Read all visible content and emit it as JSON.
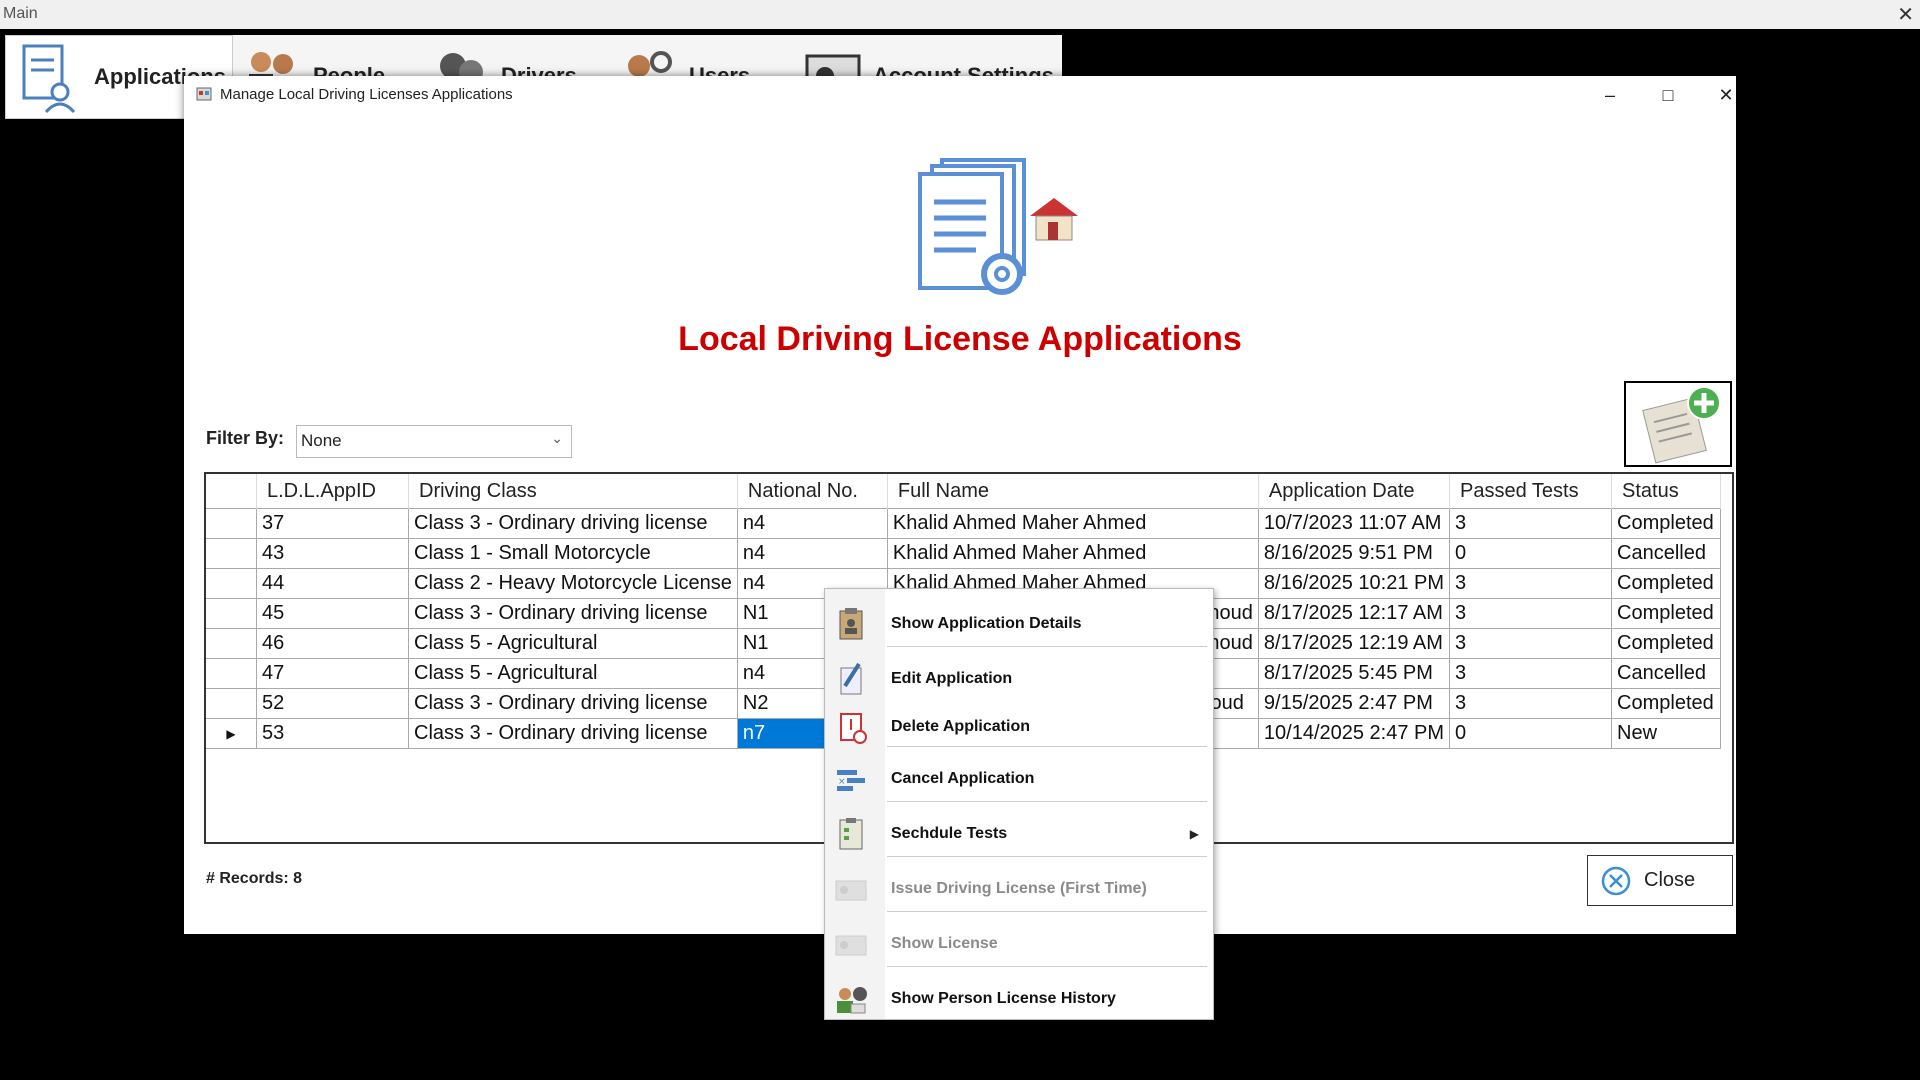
{
  "main_window": {
    "title": "Main"
  },
  "toolbar": {
    "items": [
      {
        "label": "Applications"
      },
      {
        "label": "People"
      },
      {
        "label": "Drivers"
      },
      {
        "label": "Users"
      },
      {
        "label": "Account Settings"
      }
    ]
  },
  "child_window": {
    "title": "Manage Local Driving Licenses Applications",
    "heading": "Local Driving License Applications",
    "heading_color": "#cc0000"
  },
  "filter": {
    "label": "Filter By:",
    "value": "None"
  },
  "grid": {
    "columns": [
      "L.D.L.AppID",
      "Driving Class",
      "National No.",
      "Full Name",
      "Application Date",
      "Passed Tests",
      "Status"
    ],
    "rows": [
      [
        "37",
        "Class 3 - Ordinary driving license",
        "n4",
        "Khalid Ahmed Maher Ahmed",
        "10/7/2023 11:07 AM",
        "3",
        "Completed"
      ],
      [
        "43",
        "Class 1 - Small Motorcycle",
        "n4",
        "Khalid Ahmed Maher Ahmed",
        "8/16/2025 9:51 PM",
        "0",
        "Cancelled"
      ],
      [
        "44",
        "Class 2 - Heavy Motorcycle License",
        "n4",
        "Khalid Ahmed Maher Ahmed",
        "8/16/2025 10:21 PM",
        "3",
        "Completed"
      ],
      [
        "45",
        "Class 3 - Ordinary driving license",
        "N1",
        "houd",
        "8/17/2025 12:17 AM",
        "3",
        "Completed"
      ],
      [
        "46",
        "Class 5 - Agricultural",
        "N1",
        "houd",
        "8/17/2025 12:19 AM",
        "3",
        "Completed"
      ],
      [
        "47",
        "Class 5 - Agricultural",
        "n4",
        "",
        "8/17/2025 5:45 PM",
        "3",
        "Cancelled"
      ],
      [
        "52",
        "Class 3 - Ordinary driving license",
        "N2",
        "oud",
        "9/15/2025 2:47 PM",
        "3",
        "Completed"
      ],
      [
        "53",
        "Class 3 - Ordinary driving license",
        "n7",
        "",
        "10/14/2025 2:47 PM",
        "0",
        "New"
      ]
    ],
    "selected_row_index": 7
  },
  "records": {
    "label": "# Records:",
    "count": "8"
  },
  "close_button": {
    "label": "Close"
  },
  "context_menu": {
    "items": [
      {
        "label": "Show Application Details",
        "enabled": true
      },
      {
        "label": "Edit Application",
        "enabled": true
      },
      {
        "label": "Delete Application",
        "enabled": true
      },
      {
        "label": "Cancel Application",
        "enabled": true
      },
      {
        "label": "Sechdule Tests",
        "enabled": true,
        "submenu": true
      },
      {
        "label": "Issue Driving License (First Time)",
        "enabled": false
      },
      {
        "label": "Show License",
        "enabled": false
      },
      {
        "label": "Show Person License History",
        "enabled": true
      }
    ]
  }
}
